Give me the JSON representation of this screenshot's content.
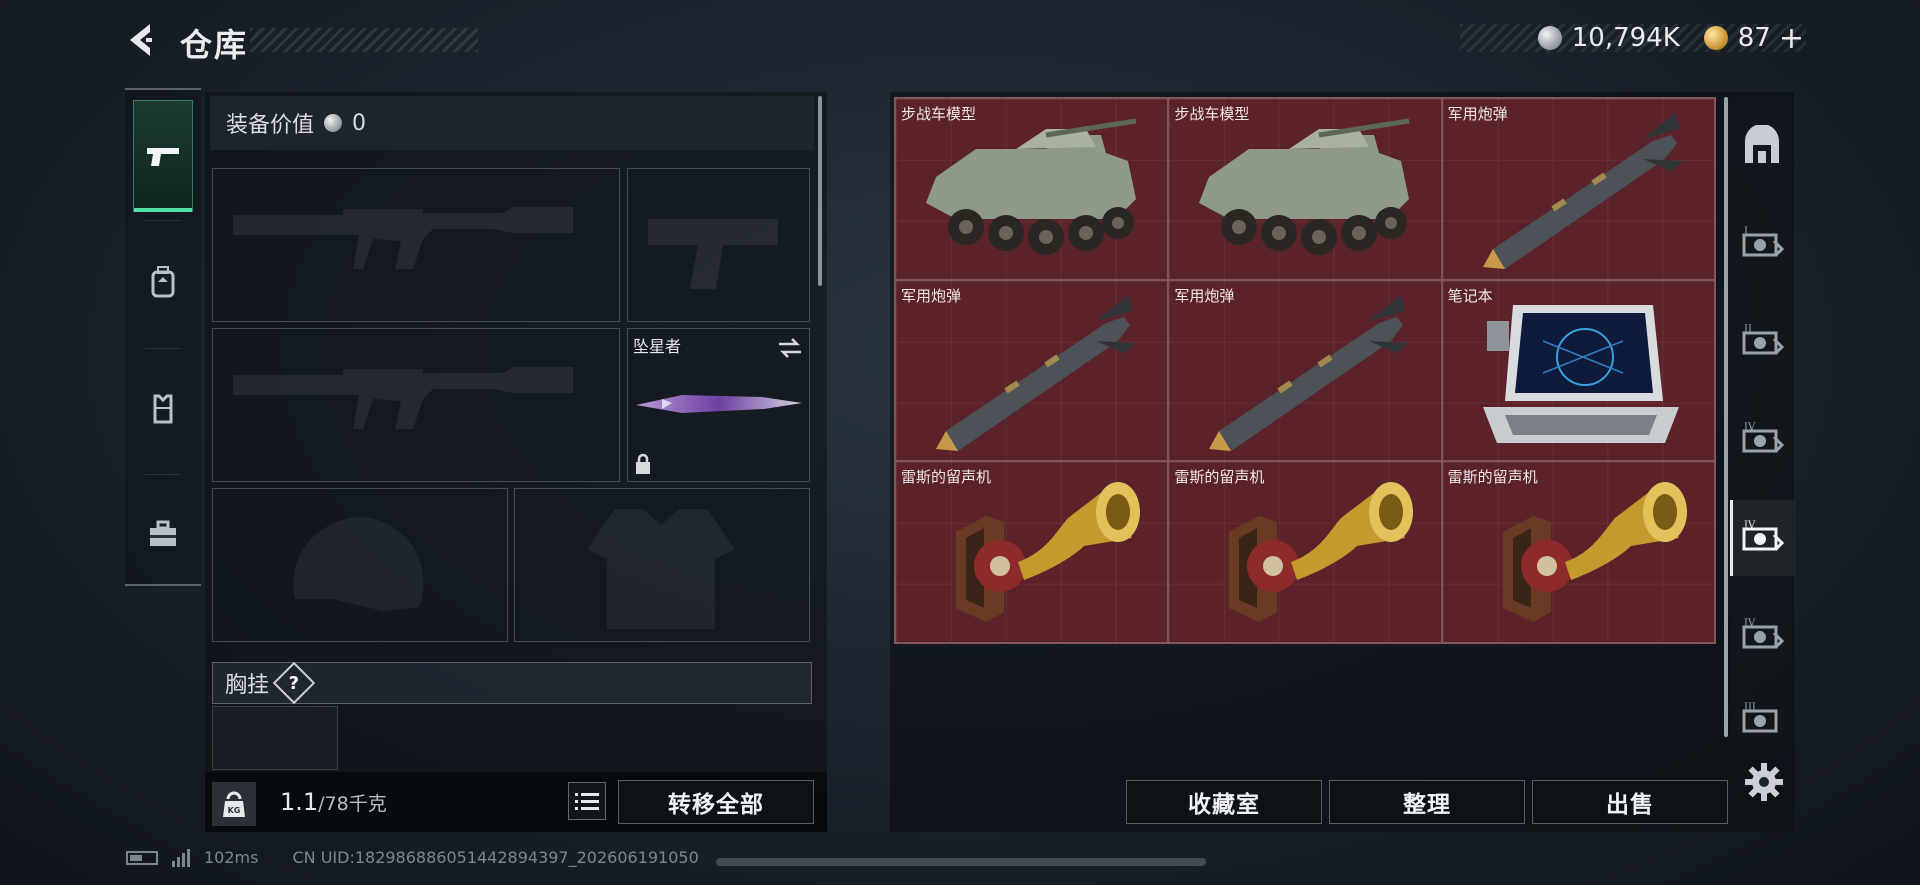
{
  "header": {
    "title": "仓库",
    "currency": [
      {
        "icon": "silver-coin-icon",
        "amount": "10,794K"
      },
      {
        "icon": "gold-coin-icon",
        "amount": "87"
      }
    ],
    "add_symbol": "+"
  },
  "left_tabs": [
    {
      "icon": "pistol-icon",
      "active": true
    },
    {
      "icon": "backpack-icon",
      "active": false
    },
    {
      "icon": "chest-rig-icon",
      "active": false
    },
    {
      "icon": "toolbox-icon",
      "active": false
    }
  ],
  "loadout": {
    "value_label": "装备价值",
    "value_amount": "0",
    "melee_slot_label": "坠星者",
    "chest_label": "胸挂",
    "help_symbol": "?",
    "weight_current": "1.1",
    "weight_max": "/78千克",
    "weight_icon_text": "KG",
    "transfer_all_label": "转移全部"
  },
  "storage": {
    "items": [
      {
        "name": "步战车模型",
        "kind": "ifv"
      },
      {
        "name": "步战车模型",
        "kind": "ifv"
      },
      {
        "name": "军用炮弹",
        "kind": "shell"
      },
      {
        "name": "军用炮弹",
        "kind": "shell"
      },
      {
        "name": "军用炮弹",
        "kind": "shell"
      },
      {
        "name": "笔记本",
        "kind": "laptop"
      },
      {
        "name": "雷斯的留声机",
        "kind": "gramophone"
      },
      {
        "name": "雷斯的留声机",
        "kind": "gramophone"
      },
      {
        "name": "雷斯的留声机",
        "kind": "gramophone"
      }
    ],
    "grid_color": "#5b2329",
    "buttons": {
      "collection": "收藏室",
      "sort": "整理",
      "sell": "出售"
    }
  },
  "right_filters": [
    {
      "icon": "all-items-icon",
      "active": false
    },
    {
      "icon": "tier-i-category-icon",
      "active": false
    },
    {
      "icon": "tier-ii-category-icon",
      "active": false
    },
    {
      "icon": "tier-iv-category-icon",
      "active": false
    },
    {
      "icon": "tier-iv-active-category-icon",
      "active": true
    },
    {
      "icon": "tier-iv-alt-category-icon",
      "active": false
    },
    {
      "icon": "tier-iii-category-icon",
      "active": false
    }
  ],
  "footer": {
    "ping": "102ms",
    "uid": "CN UID:18298688605144289439​7_202606191050"
  }
}
